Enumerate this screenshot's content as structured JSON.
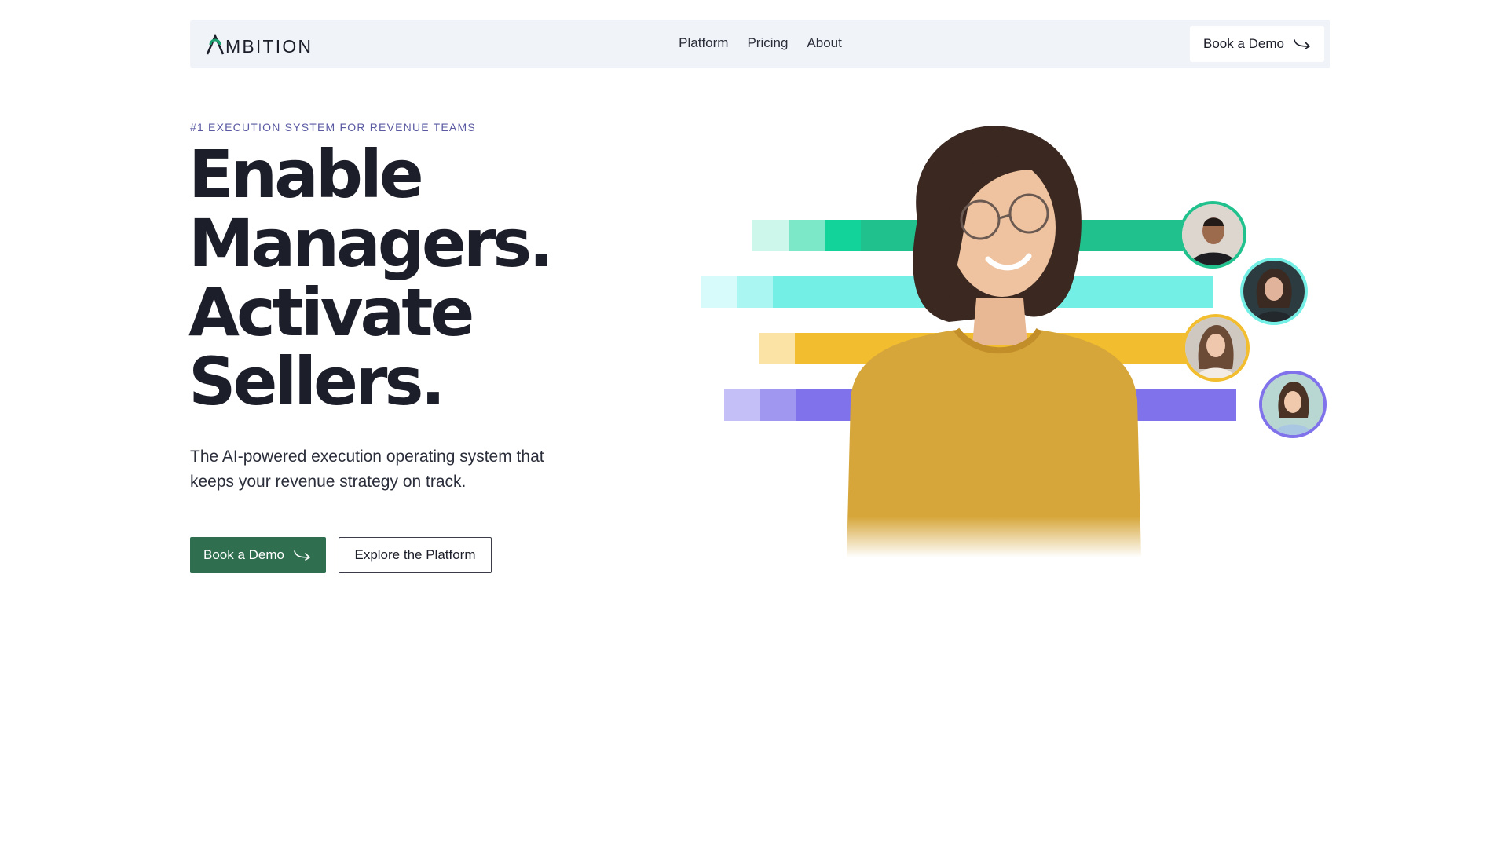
{
  "nav": {
    "logo_text": "MBITION",
    "links": [
      {
        "label": "Platform"
      },
      {
        "label": "Pricing"
      },
      {
        "label": "About"
      }
    ],
    "cta_label": "Book a Demo",
    "cta_icon": "arrow-icon"
  },
  "hero": {
    "eyebrow": "#1 EXECUTION SYSTEM FOR REVENUE TEAMS",
    "headline": [
      "Enable",
      "Managers.",
      "Activate",
      "Sellers."
    ],
    "subtext": "The AI-powered execution operating system that keeps your revenue strategy on track.",
    "primary_cta": "Book a Demo",
    "secondary_cta": "Explore the Platform"
  },
  "colors": {
    "brand_green": "#2f6f4f",
    "logo_accent": "#1a9e6e",
    "bar_green": "#21c18e",
    "bar_cyan": "#73efe6",
    "bar_yellow": "#f2bd2e",
    "bar_purple": "#7f72ea"
  }
}
